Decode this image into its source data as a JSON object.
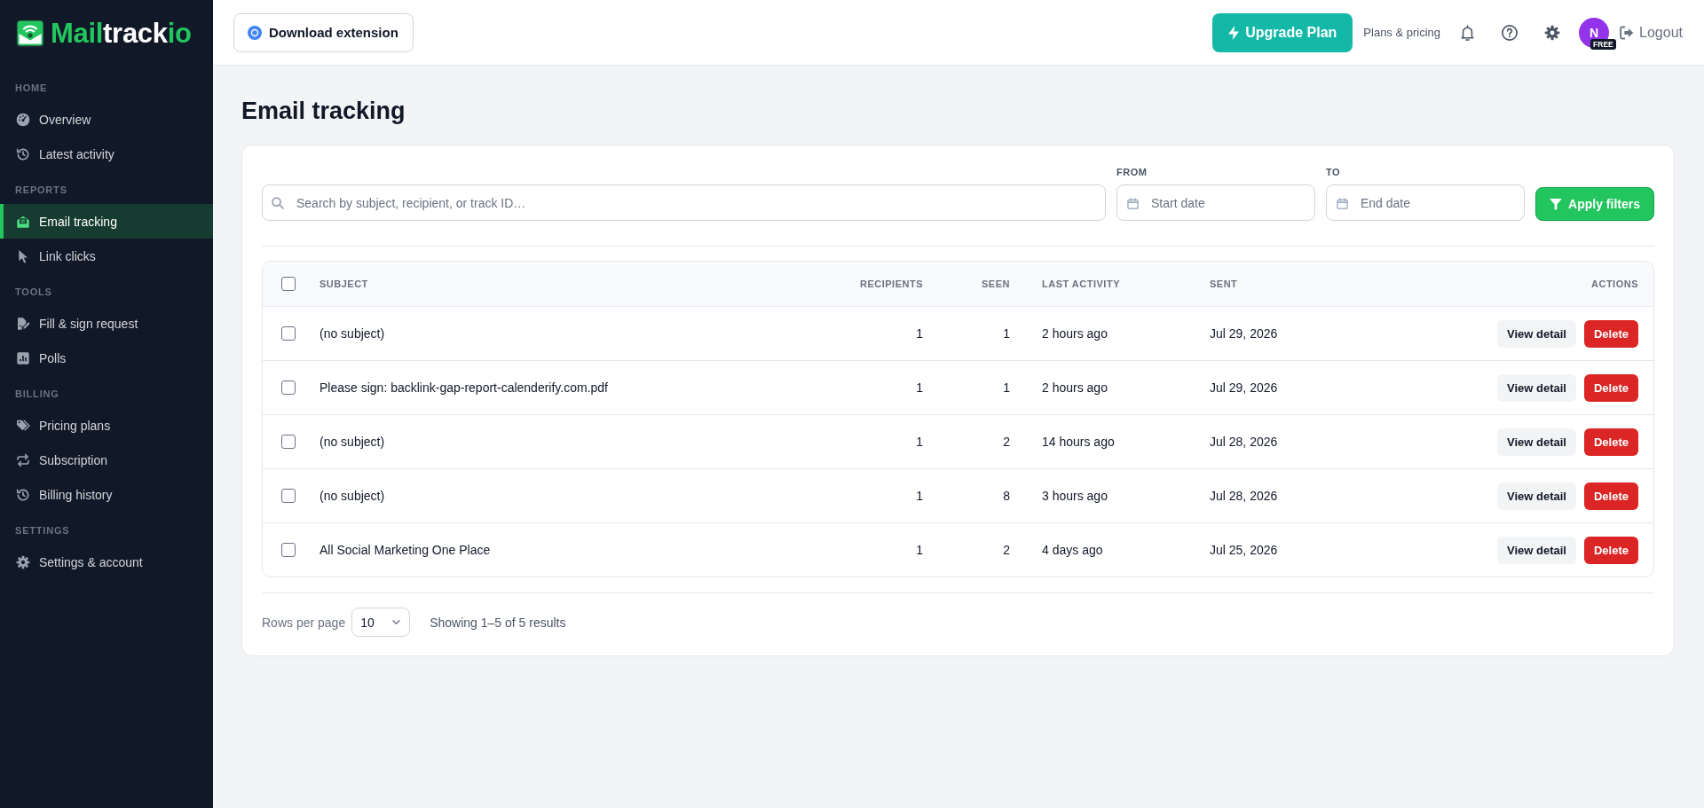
{
  "sidebar": {
    "logo": {
      "segments": [
        {
          "text": "Mail",
          "color": "#22c55e"
        },
        {
          "text": "track",
          "color": "#ffffff"
        },
        {
          "text": "io",
          "color": "#22c55e"
        }
      ]
    },
    "sections": [
      {
        "title": "HOME",
        "items": [
          {
            "label": "Overview",
            "selected": false
          },
          {
            "label": "Latest activity",
            "selected": false
          }
        ]
      },
      {
        "title": "REPORTS",
        "items": [
          {
            "label": "Email tracking",
            "selected": true
          },
          {
            "label": "Link clicks",
            "selected": false
          }
        ]
      },
      {
        "title": "TOOLS",
        "items": [
          {
            "label": "Fill & sign request",
            "selected": false
          },
          {
            "label": "Polls",
            "selected": false
          }
        ]
      },
      {
        "title": "BILLING",
        "items": [
          {
            "label": "Pricing plans",
            "selected": false
          },
          {
            "label": "Subscription",
            "selected": false
          },
          {
            "label": "Billing history",
            "selected": false
          }
        ]
      },
      {
        "title": "SETTINGS",
        "items": [
          {
            "label": "Settings & account",
            "selected": false
          }
        ]
      }
    ]
  },
  "topbar": {
    "download_button": "Download extension",
    "upgrade_button": "Upgrade Plan",
    "plans_link": "Plans & pricing",
    "avatar": {
      "initial": "N",
      "badge": "FREE"
    },
    "logout_button": "Logout"
  },
  "page": {
    "title": "Email tracking"
  },
  "filters": {
    "search": {
      "placeholder": "Search by subject, recipient, or track ID…"
    },
    "from": {
      "label": "FROM",
      "placeholder": "Start date"
    },
    "to": {
      "label": "TO",
      "placeholder": "End date"
    },
    "apply_button": "Apply filters"
  },
  "table": {
    "select_all_checked": false,
    "columns": [
      "SUBJECT",
      "RECIPIENTS",
      "SEEN",
      "LAST ACTIVITY",
      "SENT",
      "ACTIONS"
    ],
    "rows": [
      {
        "checked": false,
        "subject": "(no subject)",
        "recipients": "1",
        "seen": "1",
        "last_activity": "2 hours ago",
        "sent": "Jul 29, 2026",
        "actions": [
          {
            "kind": "view",
            "label": "View detail"
          },
          {
            "kind": "delete",
            "label": "Delete"
          }
        ]
      },
      {
        "checked": false,
        "subject": "Please sign: backlink-gap-report-calenderify.com.pdf",
        "recipients": "1",
        "seen": "1",
        "last_activity": "2 hours ago",
        "sent": "Jul 29, 2026",
        "actions": [
          {
            "kind": "view",
            "label": "View detail"
          },
          {
            "kind": "delete",
            "label": "Delete"
          }
        ]
      },
      {
        "checked": false,
        "subject": "(no subject)",
        "recipients": "1",
        "seen": "2",
        "last_activity": "14 hours ago",
        "sent": "Jul 28, 2026",
        "actions": [
          {
            "kind": "view",
            "label": "View detail"
          },
          {
            "kind": "delete",
            "label": "Delete"
          }
        ]
      },
      {
        "checked": false,
        "subject": "(no subject)",
        "recipients": "1",
        "seen": "8",
        "last_activity": "3 hours ago",
        "sent": "Jul 28, 2026",
        "actions": [
          {
            "kind": "view",
            "label": "View detail"
          },
          {
            "kind": "delete",
            "label": "Delete"
          }
        ]
      },
      {
        "checked": false,
        "subject": "All Social Marketing One Place",
        "recipients": "1",
        "seen": "2",
        "last_activity": "4 days ago",
        "sent": "Jul 25, 2026",
        "actions": [
          {
            "kind": "view",
            "label": "View detail"
          },
          {
            "kind": "delete",
            "label": "Delete"
          }
        ]
      }
    ]
  },
  "pagination": {
    "rows_per_page_label": "Rows per page",
    "rows_per_page": "10",
    "summary": "Showing 1–5 of 5 results"
  }
}
